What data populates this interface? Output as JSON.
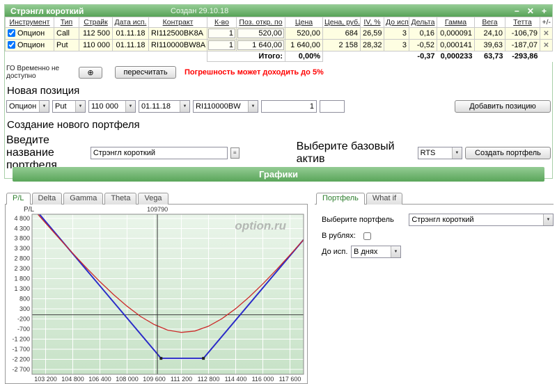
{
  "window": {
    "title": "Стрэнгл короткий",
    "created": "Создан 29.10.18",
    "controls": {
      "minimize": "−",
      "close": "✕",
      "add": "+"
    }
  },
  "icons": {
    "dropdown": "▼",
    "delete": "✕",
    "recalc": "⊕",
    "spinner": "≡"
  },
  "table": {
    "headers": [
      "Инструмент",
      "Тип",
      "Страйк",
      "Дата исп.",
      "Контракт",
      "К-во",
      "Поз. откр. по",
      "Цена",
      "Цена, руб.",
      "IV, %",
      "До исп.",
      "Дельта",
      "Гамма",
      "Вега",
      "Тетта"
    ],
    "plusminus": "+/-",
    "rows": [
      {
        "instrument": "Опцион",
        "type": "Call",
        "strike": "112 500",
        "expiry": "01.11.18",
        "contract": "RI112500BK8A",
        "qty": "1",
        "open_at": "520,00",
        "price": "520,00",
        "price_rub": "684",
        "iv": "26,59",
        "days": "3",
        "delta": "0,16",
        "gamma": "0,000091",
        "vega": "24,10",
        "theta": "-106,79"
      },
      {
        "instrument": "Опцион",
        "type": "Put",
        "strike": "110 000",
        "expiry": "01.11.18",
        "contract": "RI110000BW8A",
        "qty": "1",
        "open_at": "1 640,00",
        "price": "1 640,00",
        "price_rub": "2 158",
        "iv": "28,32",
        "days": "3",
        "delta": "-0,52",
        "gamma": "0,000141",
        "vega": "39,63",
        "theta": "-187,07"
      }
    ],
    "totals": {
      "label": "Итого:",
      "percent": "0,00%",
      "delta": "-0,37",
      "gamma": "0,000233",
      "vega": "63,73",
      "theta": "-293,86"
    }
  },
  "go_section": {
    "go_label": "ГО Временно не доступно",
    "recalc_button": "пересчитать",
    "warning": "Погрешность может доходить до 5%"
  },
  "new_position": {
    "heading": "Новая позиция",
    "type_select": "Опцион",
    "side_select": "Put",
    "strike_select": "110 000",
    "date_select": "01.11.18",
    "contract_select": "RI110000BW",
    "qty_value": "1",
    "extra_value": "",
    "add_button": "Добавить позицию"
  },
  "new_portfolio": {
    "heading": "Создание нового портфеля",
    "name_label": "Введите название портфеля",
    "name_value": "Стрэнгл короткий",
    "asset_label": "Выберите базовый актив",
    "asset_select": "RTS",
    "create_button": "Создать портфель"
  },
  "charts_header": "Графики",
  "chart_tabs": [
    "P/L",
    "Delta",
    "Gamma",
    "Theta",
    "Vega"
  ],
  "right_tabs": [
    "Портфель",
    "What if"
  ],
  "portfolio_panel": {
    "select_label": "Выберите портфель",
    "select_value": "Стрэнгл короткий",
    "rub_label": "В рублях:",
    "days_label": "До исп.",
    "days_value": "В днях"
  },
  "chart_data": {
    "type": "line",
    "title": "P/L",
    "watermark": "option.ru",
    "current_price": 109790,
    "current_price_label": "109790",
    "x_domain": [
      102400,
      118400
    ],
    "y_domain": [
      -2950,
      5000
    ],
    "x_ticks": [
      103200,
      104800,
      106400,
      108000,
      109600,
      111200,
      112800,
      114400,
      116000,
      117600
    ],
    "x_tick_labels": [
      "103 200",
      "104 800",
      "106 400",
      "108 000",
      "109 600",
      "111 200",
      "112 800",
      "114 400",
      "116 000",
      "117 600"
    ],
    "y_ticks": [
      4800,
      4300,
      3800,
      3300,
      2800,
      2300,
      1800,
      1300,
      800,
      300,
      -200,
      -700,
      -1200,
      -1700,
      -2200,
      -2700
    ],
    "y_tick_labels": [
      "4 800",
      "4 300",
      "3 800",
      "3 300",
      "2 800",
      "2 300",
      "1 800",
      "1 300",
      "800",
      "300",
      "-200",
      "-700",
      "-1 200",
      "-1 700",
      "-2 200",
      "-2 700"
    ],
    "series": [
      {
        "name": "expiry-payoff",
        "color": "#2b2bc8",
        "width": 2,
        "points": [
          [
            102400,
            5440
          ],
          [
            110000,
            -2160
          ],
          [
            112500,
            -2160
          ],
          [
            118400,
            3740
          ]
        ]
      },
      {
        "name": "current-value",
        "color": "#cc2a2a",
        "width": 1.3,
        "points": [
          [
            102400,
            5330
          ],
          [
            103200,
            4560
          ],
          [
            104000,
            3800
          ],
          [
            104800,
            3060
          ],
          [
            105600,
            2340
          ],
          [
            106400,
            1650
          ],
          [
            107200,
            1010
          ],
          [
            108000,
            430
          ],
          [
            108800,
            -80
          ],
          [
            109600,
            -480
          ],
          [
            110400,
            -760
          ],
          [
            111200,
            -870
          ],
          [
            112000,
            -800
          ],
          [
            112800,
            -560
          ],
          [
            113600,
            -180
          ],
          [
            114400,
            310
          ],
          [
            115200,
            890
          ],
          [
            116000,
            1540
          ],
          [
            116800,
            2240
          ],
          [
            117600,
            2980
          ],
          [
            118400,
            3740
          ]
        ]
      }
    ],
    "markers": [
      [
        110000,
        -2160
      ],
      [
        112500,
        -2160
      ]
    ],
    "zero_line": 0,
    "grid": true,
    "bg_top": "#eaf5ea",
    "bg_bottom": "#c7e2c7",
    "grid_color": "#ffffff"
  }
}
